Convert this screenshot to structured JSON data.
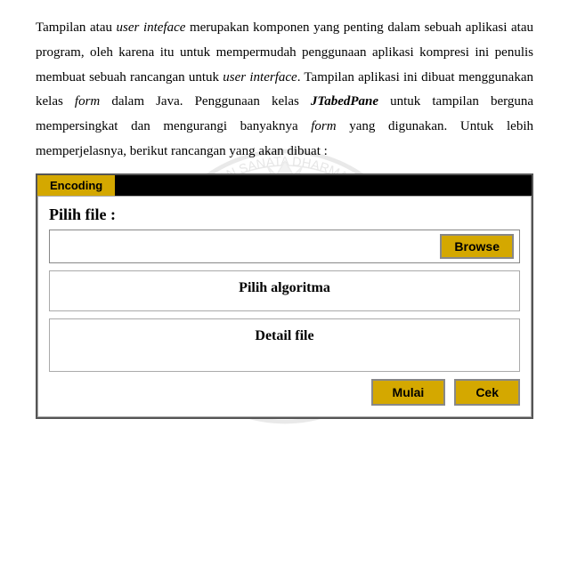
{
  "paragraph": {
    "line1_pre": "Tampilan atau ",
    "line1_italic": "user inteface",
    "line1_post": " merupakan komponen yang penting dalam sebuah aplikasi atau program, oleh karena itu untuk mempermudah penggunaan aplikasi kompresi ini penulis membuat sebuah rancangan untuk ",
    "line1_italic2": "user interface",
    "line1_post2": ". Tampilan aplikasi ini dibuat menggunakan kelas ",
    "line2_italic": "form",
    "line2_post": " dalam Java. Penggunaan kelas ",
    "line3_italic": "JTabedPane",
    "line3_post": " untuk tampilan berguna mempersingkat dan mengurangi banyaknya ",
    "line4_italic": "form",
    "line4_post": " yang digunakan. Untuk lebih memperjelasnya, berikut rancangan yang akan dibuat :"
  },
  "tabs": [
    {
      "label": "Encoding",
      "active": true
    }
  ],
  "file_section": {
    "label": "Pilih file :",
    "input_value": "",
    "browse_label": "Browse"
  },
  "algo_section": {
    "title": "Pilih algoritma"
  },
  "detail_section": {
    "title": "Detail file"
  },
  "actions": {
    "mulai_label": "Mulai",
    "cek_label": "Cek"
  }
}
